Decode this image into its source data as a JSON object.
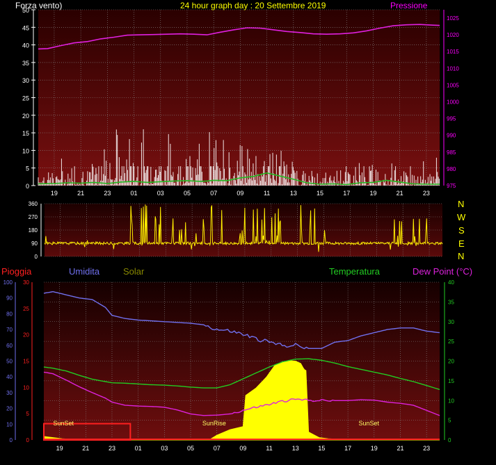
{
  "colors": {
    "wind": "#f0e6e6",
    "gust_green": "#22bb22",
    "pressure": "#e020e0",
    "direction": "#ffee00",
    "rain": "#ff2020",
    "humidity": "#7070ee",
    "solar": "#ffff00",
    "temperature": "#22cc22",
    "dewpoint": "#dd22dd",
    "grid": "#8a8a8a",
    "solar_label": "#888800"
  },
  "chart_data": [
    {
      "type": "line",
      "title": "24 hour graph day : 20 Settembre 2019",
      "left_label": "Forza vento)",
      "right_label": "Pressione",
      "x_ticks": [
        "19",
        "21",
        "23",
        "01",
        "03",
        "05",
        "07",
        "09",
        "11",
        "13",
        "15",
        "17",
        "19",
        "21",
        "23"
      ],
      "y_left_ticks": [
        "0",
        "5",
        "10",
        "15",
        "20",
        "25",
        "30",
        "35",
        "40",
        "45",
        "50"
      ],
      "ylim_left": [
        0,
        50
      ],
      "y_right_ticks": [
        "975",
        "980",
        "985",
        "990",
        "995",
        "1000",
        "1005",
        "1010",
        "1015",
        "1020",
        "1025"
      ],
      "ylim_right": [
        975,
        1027.5
      ],
      "grid": true,
      "series": [
        {
          "key": "pressure",
          "color_key": "pressure",
          "axis": "right",
          "x": [
            17.8,
            18.5,
            19.5,
            20.5,
            21.5,
            22.5,
            23.5,
            24.5,
            25.5,
            26.5,
            27.5,
            28.5,
            29.5,
            30.5,
            31.5,
            32.5,
            33.5,
            34.5,
            35.5,
            36.5,
            37.5,
            38.5,
            39.5,
            40.5,
            41.5,
            42.5,
            43.5,
            44.5,
            45.5,
            46.5,
            47.5,
            48
          ],
          "y": [
            1015.8,
            1015.9,
            1016.8,
            1017.6,
            1018,
            1018.8,
            1019.3,
            1019.9,
            1020,
            1020.1,
            1020.2,
            1020.3,
            1020.2,
            1020,
            1020.8,
            1021.5,
            1022.1,
            1022.0,
            1021.5,
            1021.0,
            1020.7,
            1020.3,
            1020.2,
            1020.3,
            1020.6,
            1021.2,
            1022,
            1022.7,
            1023,
            1023.1,
            1022.9,
            1022.8
          ]
        },
        {
          "key": "wind_speed_avg",
          "color_key": "gust_green",
          "axis": "left",
          "x": [
            17.8,
            19,
            20,
            21,
            22,
            23,
            24,
            25,
            26,
            27,
            28,
            29,
            30,
            30.5,
            31,
            32,
            33,
            34,
            35,
            36,
            37,
            38,
            39,
            40,
            41,
            42,
            43,
            44,
            45,
            46,
            47,
            48
          ],
          "y": [
            0.5,
            0.6,
            0.8,
            0.7,
            0.9,
            0.6,
            1.0,
            1.2,
            0.9,
            1.1,
            1.3,
            1.4,
            1.2,
            1.3,
            1.5,
            1.4,
            2.2,
            2.6,
            3.6,
            2.7,
            1.8,
            0.8,
            0.4,
            0.5,
            0.3,
            0.8,
            0.9,
            1.5,
            1.0,
            0.5,
            0.4,
            0.4
          ]
        }
      ],
      "wind_gust_profile_note": "",
      "wind_gust_range": {
        "x": [
          17.8,
          48
        ],
        "peak_y": 16.5
      }
    },
    {
      "type": "line",
      "right_labels": [
        "N",
        "W",
        "S",
        "E",
        "N"
      ],
      "y_ticks": [
        "0",
        "90",
        "180",
        "270",
        "360"
      ],
      "ylim": [
        0,
        360
      ],
      "series": [
        {
          "key": "wind_direction",
          "color_key": "direction",
          "baseline": 90
        }
      ]
    },
    {
      "type": "area",
      "header_labels": {
        "rain": "Pioggia",
        "humidity": "Umidita",
        "solar": "Solar",
        "temperature": "Temperatura",
        "dewpoint": "Dew Point (°C)"
      },
      "x_ticks": [
        "19",
        "21",
        "23",
        "01",
        "03",
        "05",
        "07",
        "09",
        "11",
        "13",
        "15",
        "17",
        "19",
        "21",
        "23"
      ],
      "y_humidity_ticks": [
        "0",
        "10",
        "20",
        "30",
        "40",
        "50",
        "60",
        "70",
        "80",
        "90",
        "100"
      ],
      "y_rain_ticks": [
        "0",
        "5",
        "10",
        "15",
        "20",
        "25",
        "30"
      ],
      "y_temp_ticks": [
        "0",
        "5",
        "10",
        "15",
        "20",
        "25",
        "30",
        "35",
        "40"
      ],
      "ylim_humidity": [
        0,
        100
      ],
      "ylim_rain": [
        0,
        30
      ],
      "ylim_temp": [
        0,
        40
      ],
      "annotations": [
        {
          "text": "SunSet",
          "x": 19.3
        },
        {
          "text": "SunRise",
          "x": 30.8
        },
        {
          "text": "SunSet",
          "x": 42.6
        }
      ],
      "series": [
        {
          "key": "humidity",
          "axis": "humidity",
          "x": [
            17.8,
            18.5,
            19.5,
            20.5,
            21.5,
            22.5,
            23.0,
            24,
            25,
            26,
            27,
            28,
            29,
            30,
            31,
            32,
            33,
            34,
            35,
            36,
            37,
            38,
            39,
            40,
            41,
            42,
            43,
            44,
            45,
            46,
            47,
            48
          ],
          "y": [
            93,
            94,
            92,
            90,
            89,
            84,
            79,
            77,
            76,
            75.5,
            75,
            74.5,
            74,
            73,
            70,
            69,
            67,
            64,
            62,
            60,
            60,
            58,
            58,
            62,
            63,
            66,
            68,
            70,
            71,
            71,
            69,
            68
          ]
        },
        {
          "key": "temperature",
          "axis": "temp",
          "x": [
            17.8,
            18.5,
            19.5,
            20.5,
            21.5,
            22.5,
            23,
            24,
            25,
            26,
            27,
            28,
            29,
            30,
            31,
            32,
            33,
            34,
            35,
            36,
            37,
            38,
            39,
            40,
            41,
            42,
            43,
            44,
            45,
            46,
            47,
            48
          ],
          "y": [
            18.5,
            18.2,
            17.5,
            16.4,
            15.4,
            14.8,
            14.5,
            14.4,
            14.2,
            14.0,
            13.9,
            13.7,
            13.4,
            13.2,
            13.2,
            14,
            15.5,
            17,
            18.5,
            19.8,
            20.5,
            20.6,
            20.2,
            19.5,
            18.6,
            17.9,
            17.2,
            16.5,
            15.6,
            14.8,
            13.8,
            12.8
          ]
        },
        {
          "key": "dewpoint",
          "axis": "temp",
          "x": [
            17.8,
            18.5,
            19.5,
            20.5,
            21.5,
            22.5,
            23,
            24,
            25,
            26,
            27,
            28,
            29,
            30,
            31,
            32,
            33,
            34,
            35,
            36,
            37,
            38,
            39,
            40,
            41,
            42,
            43,
            44,
            45,
            46,
            47,
            48
          ],
          "y": [
            17.2,
            16.8,
            15.2,
            13.5,
            12,
            10.6,
            9.6,
            8.8,
            8.6,
            8.5,
            8.3,
            7.6,
            6.6,
            6.2,
            6.3,
            6.6,
            7.5,
            8.3,
            9,
            9.8,
            10.3,
            10.1,
            10.0,
            10.0,
            10.0,
            10.2,
            10.1,
            9.6,
            9.3,
            8.8,
            7.5,
            6.2
          ]
        },
        {
          "key": "solar",
          "axis": "temp",
          "fill": true,
          "x": [
            17.8,
            18.5,
            19.2,
            20.0,
            21.0,
            22.0,
            29.9,
            30.5,
            31.0,
            32.0,
            33.0,
            33.2,
            34.0,
            34.8,
            35.4,
            36.0,
            36.5,
            37.0,
            37.4,
            37.6,
            37.7,
            37.8,
            38.0,
            38.8,
            39.5,
            41.5,
            48
          ],
          "y": [
            0.9,
            0.6,
            0.3,
            0.15,
            0.05,
            0,
            0,
            0.2,
            1.2,
            2.6,
            3.4,
            11.3,
            13.2,
            16.0,
            18.8,
            19.8,
            20.1,
            20.0,
            19.4,
            18.2,
            17.8,
            17.6,
            2.0,
            0.6,
            0.3,
            0,
            0
          ]
        }
      ],
      "rain_box": {
        "x0": 17.8,
        "x1": 24.4,
        "y_mm": 3.1
      }
    }
  ]
}
